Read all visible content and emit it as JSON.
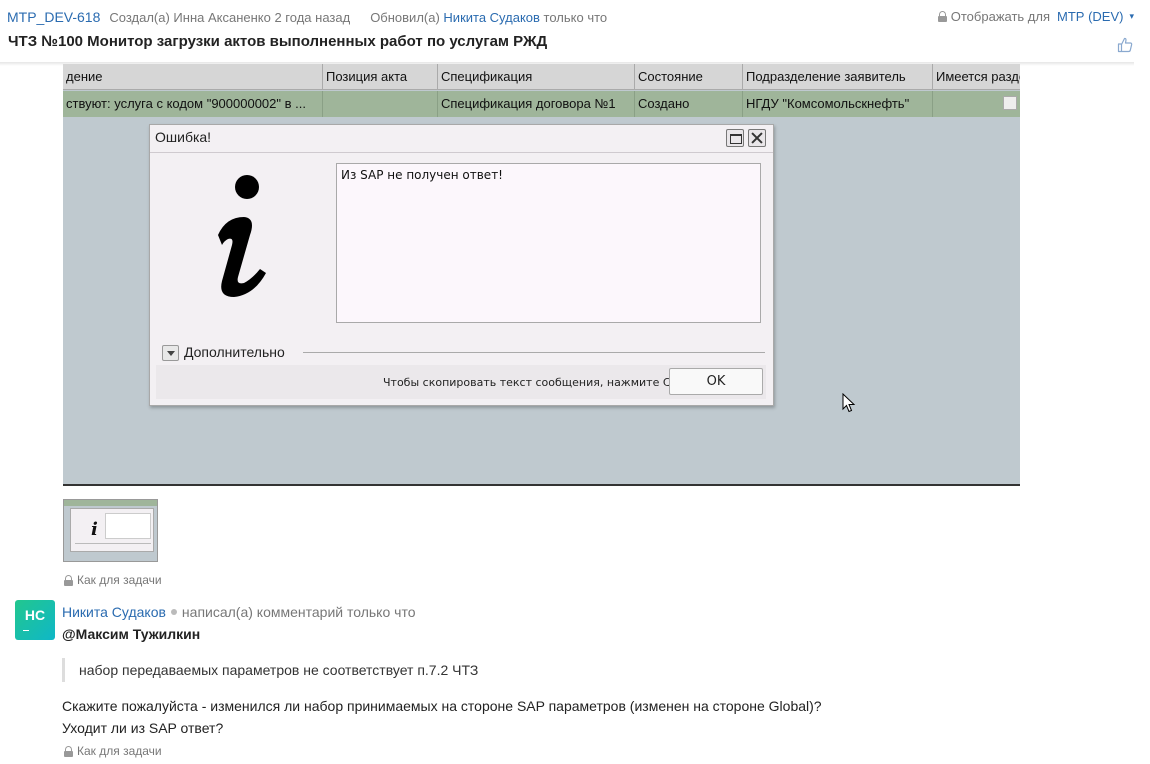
{
  "header": {
    "issue_key": "MTP_DEV-618",
    "created_text": "Создал(а) Инна Аксаненко 2 года назад",
    "updated_prefix": "Обновил(а)",
    "updated_author": "Никита Судаков",
    "updated_when": "только что",
    "visibility_prefix": "Отображать для",
    "visibility_value": "МТР (DEV)",
    "caret": "▾",
    "title": "ЧТЗ №100 Монитор загрузки актов выполненных работ по услугам РЖД"
  },
  "screenshot": {
    "grid": {
      "columns": [
        "дение",
        "Позиция акта",
        "Спецификация",
        "Состояние",
        "Подразделение заявитель",
        "Имеется разде"
      ],
      "row": [
        "ствуют: услуга с кодом \"900000002\" в ...",
        "",
        "Спецификация договора №1",
        "Создано",
        "НГДУ \"Комсомольскнефть\"",
        ""
      ]
    },
    "dialog": {
      "title": "Ошибка!",
      "message": "Из SAP не получен ответ!",
      "more_label": "Дополнительно",
      "footer_hint": "Чтобы скопировать текст сообщения, нажмите Ctrl+C",
      "ok_label": "OK"
    }
  },
  "thumbnail_icon_glyph": "i",
  "attachment_visibility": "Как для задачи",
  "comment": {
    "avatar_initials": "НС",
    "author": "Никита Судаков",
    "action": "написал(а) комментарий только что",
    "mention": "@Максим Тужилкин",
    "quote": "набор передаваемых параметров не соответствует п.7.2 ЧТЗ",
    "paragraph1": "Скажите пожалуйста - изменился ли набор принимаемых на стороне SAP параметров (изменен на стороне Global)?",
    "paragraph2": "Уходит ли из SAP ответ?",
    "visibility": "Как для задачи"
  },
  "colors": {
    "link": "#2a6bb0",
    "avatar": "#18c5a0",
    "grid_selected_row": "#9fb59a",
    "screenshot_bg": "#bfc9cf"
  }
}
